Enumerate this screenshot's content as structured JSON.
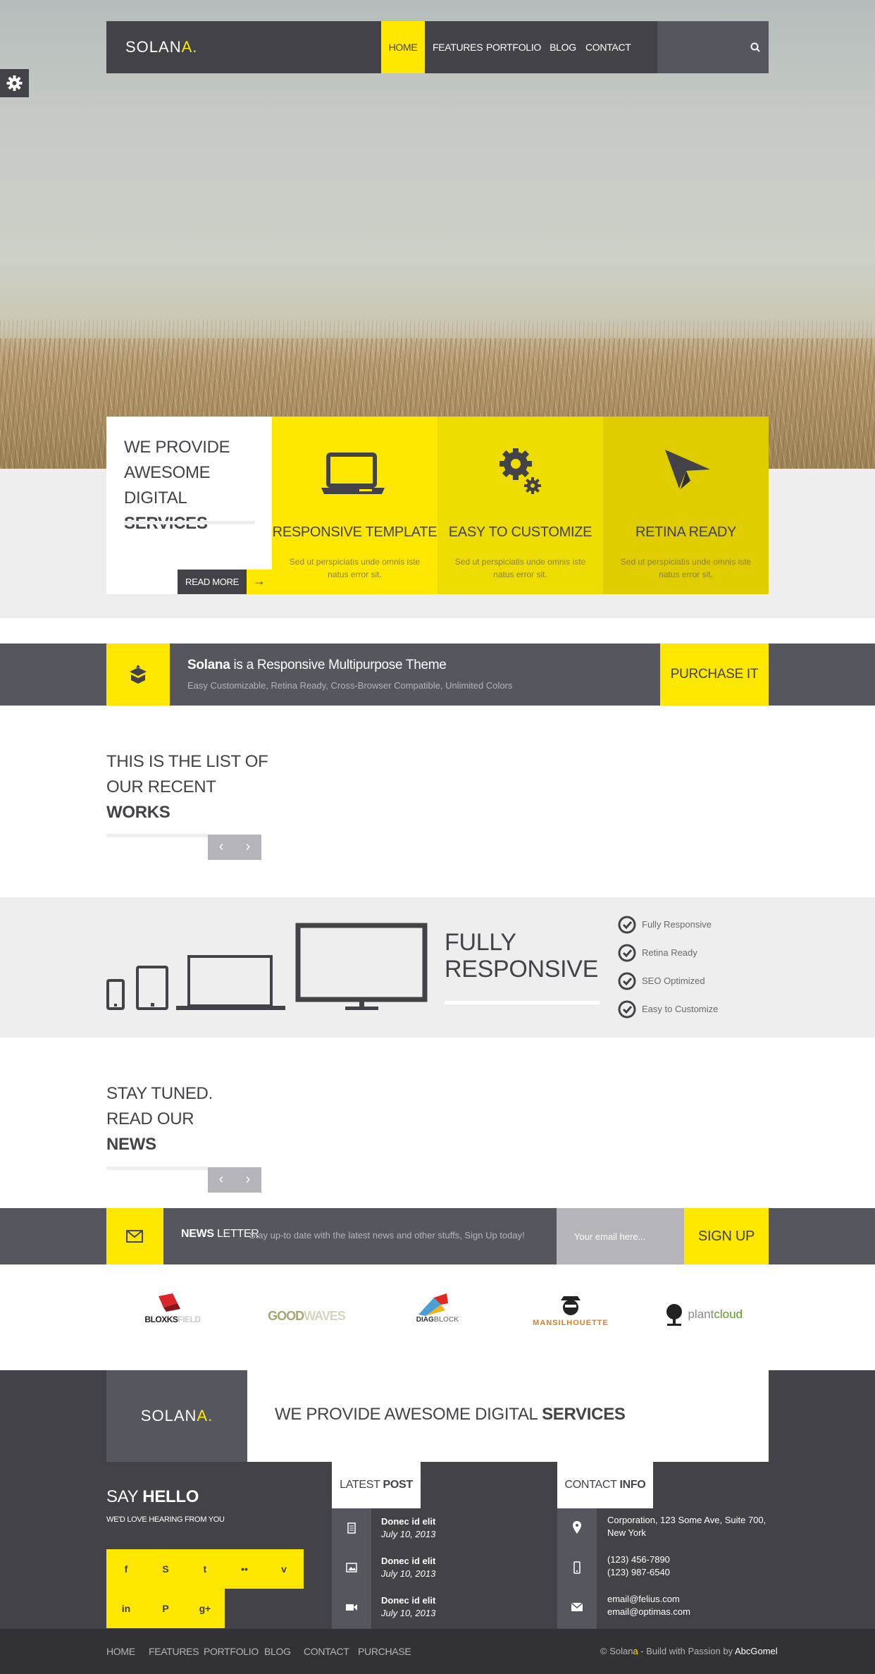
{
  "brand": {
    "name": "SOLAN",
    "accent": "A.",
    "accent_color": "#ffe800"
  },
  "colors": {
    "yellow": "#ffe800",
    "dark": "#434248",
    "mid": "#56565e",
    "light": "#eeeeee"
  },
  "nav": {
    "items": [
      "HOME",
      "FEATURES",
      "PORTFOLIO",
      "BLOG",
      "CONTACT"
    ],
    "active": "HOME",
    "search_icon": "search-icon"
  },
  "settings_icon": "gear-icon",
  "intro": {
    "line1": "WE PROVIDE",
    "line2": "AWESOME DIGITAL",
    "line3": "SERVICES",
    "read_more": "READ MORE",
    "arrow": "→"
  },
  "services": [
    {
      "icon": "laptop-icon",
      "title": "RESPONSIVE TEMPLATE",
      "desc": "Sed ut perspiciatis unde omnis iste natus error sit.",
      "color": "#ffe800"
    },
    {
      "icon": "gears-icon",
      "title": "EASY TO CUSTOMIZE",
      "desc": "Sed ut perspiciatis unde omnis iste natus error sit.",
      "color": "#eedd00"
    },
    {
      "icon": "paper-plane-icon",
      "title": "RETINA READY",
      "desc": "Sed ut perspiciatis unde omnis iste natus error sit.",
      "color": "#dfcd00"
    }
  ],
  "purchase": {
    "brand": "Solana",
    "title_rest": " is a Responsive Multipurpose Theme",
    "subtitle": "Easy Customizable, Retina Ready, Cross-Browser Compatible, Unlimited Colors",
    "button": "PURCHASE IT",
    "icon": "box-icon"
  },
  "works": {
    "line1": "THIS IS THE LIST OF",
    "line2": "OUR RECENT",
    "line3": "WORKS",
    "prev": "‹",
    "next": "›"
  },
  "responsive": {
    "line1": "FULLY",
    "line2": "RESPONSIVE",
    "features": [
      "Fully Responsive",
      "Retina Ready",
      "SEO Optimized",
      "Easy to Customize"
    ]
  },
  "news": {
    "line1": "STAY TUNED.",
    "line2": "READ OUR",
    "line3": "NEWS",
    "prev": "‹",
    "next": "›"
  },
  "newsletter": {
    "bold": "NEWS",
    "rest": " LETTER",
    "desc": "Stay up-to date with the latest news and other stuffs, Sign Up today!",
    "placeholder": "Your email here...",
    "button": "SIGN UP",
    "icon": "envelope-icon"
  },
  "clients": [
    {
      "a": "BLOXKS",
      "b": "FIELD"
    },
    {
      "a": "GOOD",
      "b": "WAVES"
    },
    {
      "a": "DIAG",
      "b": "BLOCK"
    },
    {
      "a": "MAN",
      "b": "SILHOUETTE"
    },
    {
      "a": "plant",
      "b": "cloud"
    }
  ],
  "footer": {
    "logo": "SOLAN",
    "logo_accent": "A.",
    "tagline": "WE PROVIDE AWESOME DIGITAL ",
    "tagline_bold": "SERVICES",
    "say": "SAY ",
    "say_bold": "HELLO",
    "say_sub": "WE'D LOVE HEARING FROM YOU",
    "social": [
      "f",
      "S",
      "t",
      "••",
      "v",
      "in",
      "P",
      "g+"
    ],
    "latest": {
      "a": "LATEST ",
      "b": "POST"
    },
    "posts": [
      {
        "title": "Donec id elit",
        "date": "July 10, 2013",
        "icon": "document-icon"
      },
      {
        "title": "Donec id elit",
        "date": "July 10, 2013",
        "icon": "image-icon"
      },
      {
        "title": "Donec id elit",
        "date": "July 10, 2013",
        "icon": "video-icon"
      }
    ],
    "contact": {
      "a": "CONTACT ",
      "b": "INFO"
    },
    "address1": "Corporation, 123 Some Ave, Suite 700,",
    "address2": "New York",
    "phone1": "(123) 456-7890",
    "phone2": "(123) 987-6540",
    "email1": "email@felius.com",
    "email2": "email@optimas.com"
  },
  "bottom": {
    "nav": [
      "HOME",
      "FEATURES",
      "PORTFOLIO",
      "BLOG",
      "CONTACT",
      "PURCHASE"
    ],
    "copy_a": "© Solan",
    "copy_dot": "a",
    "copy_b": " - Build with Passion by ",
    "copy_author": "AbcGomel"
  }
}
